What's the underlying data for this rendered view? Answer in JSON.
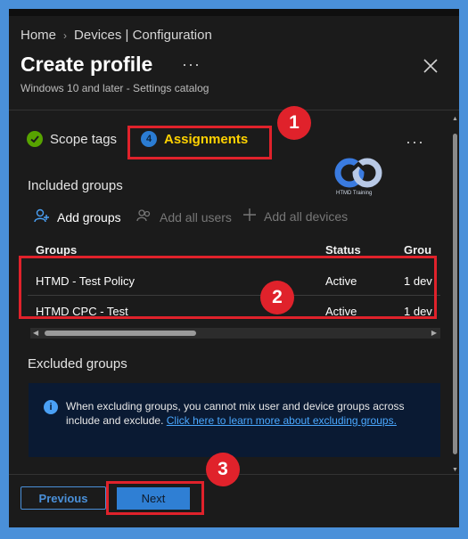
{
  "breadcrumb": {
    "home": "Home",
    "devices": "Devices | Configuration"
  },
  "title": "Create profile",
  "subtitle": "Windows 10 and later - Settings catalog",
  "tabs": {
    "scope_tags": "Scope tags",
    "assignments": "Assignments",
    "assignments_step": "4"
  },
  "logo": {
    "text": "HTMD Training"
  },
  "included": {
    "label": "Included groups",
    "actions": {
      "add_groups": "Add groups",
      "add_all_users": "Add all users",
      "add_all_devices": "Add all devices"
    },
    "columns": [
      "Groups",
      "Status",
      "Grou"
    ],
    "rows": [
      {
        "group": "HTMD - Test Policy",
        "status": "Active",
        "count": "1 dev"
      },
      {
        "group": "HTMD CPC - Test",
        "status": "Active",
        "count": "1 dev"
      }
    ]
  },
  "excluded": {
    "label": "Excluded groups",
    "info_text": "When excluding groups, you cannot mix user and device groups across include and exclude.",
    "info_link": "Click here to learn more about excluding groups."
  },
  "footer": {
    "previous": "Previous",
    "next": "Next"
  },
  "annotations": {
    "badge1": "1",
    "badge2": "2",
    "badge3": "3"
  },
  "icons": {
    "scope_tags_status": "check-circle-icon",
    "more": "more-options-icon",
    "close": "close-icon",
    "info": "info-icon"
  },
  "colors": {
    "accent": "#2f7fd4",
    "highlight": "#e0222b",
    "assign_text": "#ffd200",
    "check": "#57a300"
  }
}
